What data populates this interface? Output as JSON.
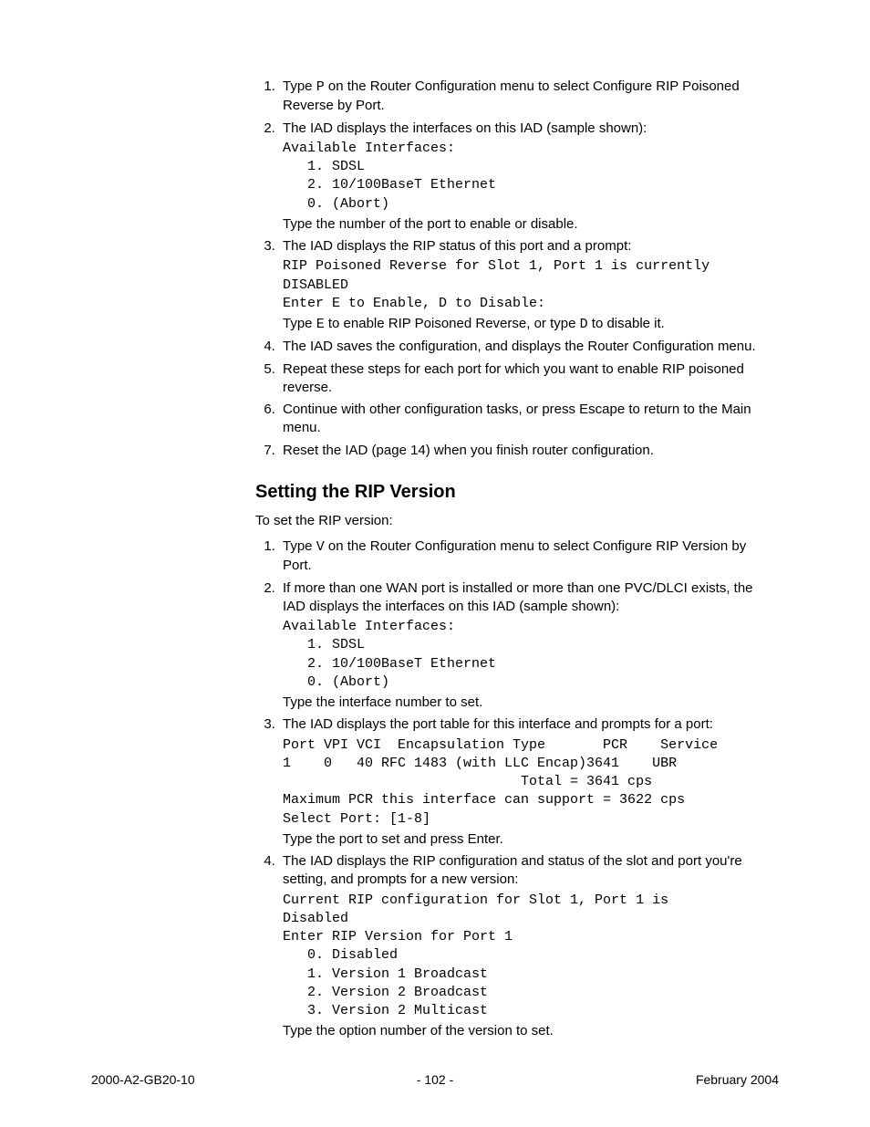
{
  "steps_a": {
    "items": [
      {
        "prefix": "Type ",
        "key": "P",
        "suffix": " on the Router Configuration menu to select Configure RIP Poisoned Reverse by Port."
      },
      {
        "text": "The IAD displays the interfaces on this IAD (sample shown):",
        "mono": "Available Interfaces:\n   1. SDSL\n   2. 10/100BaseT Ethernet\n   0. (Abort)",
        "post": "Type the number of the port to enable or disable."
      },
      {
        "text": "The IAD displays the RIP status of this port and a prompt:",
        "mono": "RIP Poisoned Reverse for Slot 1, Port 1 is currently\nDISABLED\nEnter E to Enable, D to Disable:",
        "post_prefix": "Type ",
        "key1": "E",
        "mid": " to enable RIP Poisoned Reverse, or type ",
        "key2": "D",
        "post_suffix": " to disable it."
      },
      {
        "text": "The IAD saves the configuration, and displays the Router Configuration menu."
      },
      {
        "text": "Repeat these steps for each port for which you want to enable RIP poisoned reverse."
      },
      {
        "text": "Continue with other configuration tasks, or press Escape to return to the Main menu."
      },
      {
        "text": "Reset the IAD (page 14) when you finish router configuration."
      }
    ]
  },
  "section_heading": "Setting the RIP Version",
  "section_intro": "To set the RIP version:",
  "steps_b": {
    "items": [
      {
        "prefix": "Type ",
        "key": "V",
        "suffix": " on the Router Configuration menu to select Configure RIP Version by Port."
      },
      {
        "text": "If more than one WAN port is installed or more than one PVC/DLCI exists, the IAD displays the interfaces on this IAD (sample shown):",
        "mono": "Available Interfaces:\n   1. SDSL\n   2. 10/100BaseT Ethernet\n   0. (Abort)",
        "post": "Type the interface number to set."
      },
      {
        "text": "The IAD displays the port table for this interface and prompts for a port:",
        "mono": "Port VPI VCI  Encapsulation Type       PCR    Service\n1    0   40 RFC 1483 (with LLC Encap)3641    UBR\n                             Total = 3641 cps\nMaximum PCR this interface can support = 3622 cps\nSelect Port: [1-8]",
        "post": "Type the port to set and press Enter."
      },
      {
        "text": "The IAD displays the RIP configuration and status of the slot and port you're setting, and prompts for a new version:",
        "mono": "Current RIP configuration for Slot 1, Port 1 is\nDisabled\nEnter RIP Version for Port 1\n   0. Disabled\n   1. Version 1 Broadcast\n   2. Version 2 Broadcast\n   3. Version 2 Multicast",
        "post": "Type the option number of the version to set."
      }
    ]
  },
  "footer": {
    "left": "2000-A2-GB20-10",
    "center": "- 102 -",
    "right": "February 2004"
  }
}
